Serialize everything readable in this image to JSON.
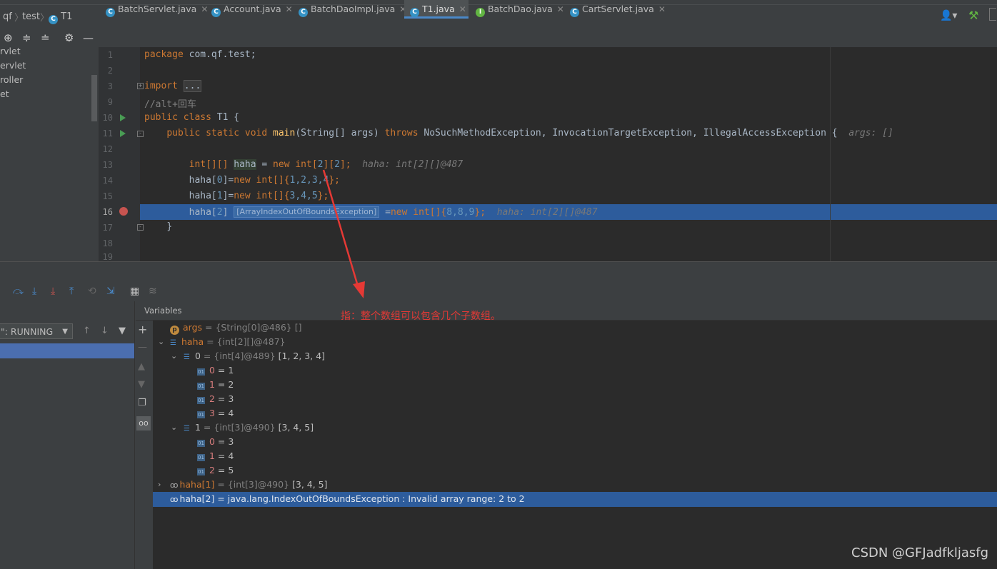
{
  "breadcrumb": {
    "root": "qf",
    "pkg": "test",
    "cls": "T1"
  },
  "tabs": [
    {
      "label": "BatchServlet.java",
      "kind": "class"
    },
    {
      "label": "Account.java",
      "kind": "class"
    },
    {
      "label": "BatchDaoImpl.java",
      "kind": "class"
    },
    {
      "label": "T1.java",
      "kind": "class"
    },
    {
      "label": "BatchDao.java",
      "kind": "interface"
    },
    {
      "label": "CartServlet.java",
      "kind": "class"
    }
  ],
  "project_items": [
    "rvlet",
    "ervlet",
    "roller",
    "et"
  ],
  "editor": {
    "line_numbers": [
      "1",
      "2",
      "3",
      "9",
      "10",
      "11",
      "12",
      "13",
      "14",
      "15",
      "16",
      "17",
      "18",
      "19"
    ],
    "line1_kw": "package",
    "line1_rest": " com.qf.test;",
    "line3_kw": "import",
    "line3_fold": "...",
    "line9_comment": "//alt+回车",
    "line10_kw": "public class",
    "line10_rest": " T1 {",
    "line11_kw1": "public static void",
    "line11_fn": "main",
    "line11_args": "(String[] args) ",
    "line11_kw2": "throws",
    "line11_ex": " NoSuchMethodException, InvocationTargetException, IllegalAccessException {",
    "line11_hint": "args: []",
    "line13_a": "int[][] ",
    "line13_var": "haha",
    "line13_b": " = ",
    "line13_new": "new",
    "line13_c": " int[",
    "line13_n1": "2",
    "line13_d": "][",
    "line13_n2": "2",
    "line13_e": "];",
    "line13_hint": "haha: int[2][]@487",
    "line14_a": "haha[",
    "line14_n0": "0",
    "line14_b": "]=",
    "line14_new": "new",
    "line14_c": " int[]{",
    "line14_vals": "1,2,3,4",
    "line14_d": "};",
    "line15_a": "haha[",
    "line15_n0": "1",
    "line15_b": "]=",
    "line15_new": "new",
    "line15_c": " int[]{",
    "line15_vals": "3,4,5",
    "line15_d": "};",
    "line16_a": "haha[",
    "line16_n0": "2",
    "line16_b": "]",
    "line16_exc": "[ArrayIndexOutOfBoundsException]",
    "line16_c": "=",
    "line16_new": "new",
    "line16_d": " int[]{",
    "line16_vals": "8,8,9",
    "line16_e": "};",
    "line16_hint": "haha: int[2][]@487",
    "line17": "}"
  },
  "debug": {
    "variables_title": "Variables",
    "thread_state": "\": RUNNING",
    "rows": {
      "args_name": "args",
      "args_val": " = {String[0]@486} []",
      "haha_name": "haha",
      "haha_type": " = {int[2][]@487}",
      "r0_name": "0",
      "r0_type": " = {int[4]@489}",
      "r0_val": " [1, 2, 3, 4]",
      "r0_0": "0",
      "r0_0v": " = 1",
      "r0_1": "1",
      "r0_1v": " = 2",
      "r0_2": "2",
      "r0_2v": " = 3",
      "r0_3": "3",
      "r0_3v": " = 4",
      "r1_name": "1",
      "r1_type": " = {int[3]@490}",
      "r1_val": " [3, 4, 5]",
      "r1_0": "0",
      "r1_0v": " = 3",
      "r1_1": "1",
      "r1_1v": " = 4",
      "r1_2": "2",
      "r1_2v": " = 5",
      "w1_name": "haha[1]",
      "w1_type": " = {int[3]@490}",
      "w1_val": " [3, 4, 5]",
      "w2_name": "haha[2]",
      "w2_val": " = java.lang.IndexOutOfBoundsException : Invalid array range: 2 to 2"
    }
  },
  "annotation": "指：整个数组可以包含几个子数组。",
  "watermark": "CSDN @GFJadfkljasfg",
  "colors": {
    "accent": "#4a88c7",
    "selection": "#2d5c9c",
    "annotation": "#e53935"
  }
}
